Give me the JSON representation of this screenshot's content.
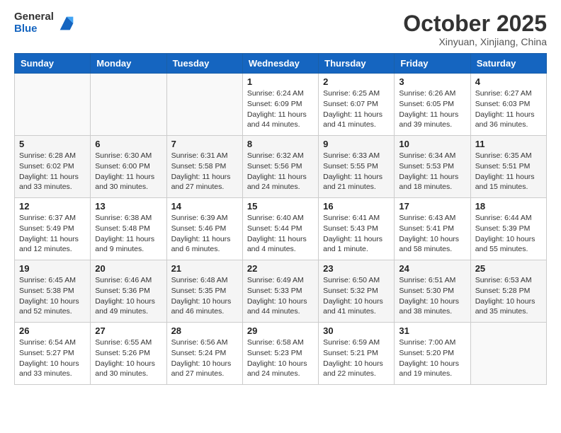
{
  "header": {
    "logo_general": "General",
    "logo_blue": "Blue",
    "month_title": "October 2025",
    "location": "Xinyuan, Xinjiang, China"
  },
  "days_of_week": [
    "Sunday",
    "Monday",
    "Tuesday",
    "Wednesday",
    "Thursday",
    "Friday",
    "Saturday"
  ],
  "weeks": [
    [
      {
        "day": "",
        "info": ""
      },
      {
        "day": "",
        "info": ""
      },
      {
        "day": "",
        "info": ""
      },
      {
        "day": "1",
        "info": "Sunrise: 6:24 AM\nSunset: 6:09 PM\nDaylight: 11 hours\nand 44 minutes."
      },
      {
        "day": "2",
        "info": "Sunrise: 6:25 AM\nSunset: 6:07 PM\nDaylight: 11 hours\nand 41 minutes."
      },
      {
        "day": "3",
        "info": "Sunrise: 6:26 AM\nSunset: 6:05 PM\nDaylight: 11 hours\nand 39 minutes."
      },
      {
        "day": "4",
        "info": "Sunrise: 6:27 AM\nSunset: 6:03 PM\nDaylight: 11 hours\nand 36 minutes."
      }
    ],
    [
      {
        "day": "5",
        "info": "Sunrise: 6:28 AM\nSunset: 6:02 PM\nDaylight: 11 hours\nand 33 minutes."
      },
      {
        "day": "6",
        "info": "Sunrise: 6:30 AM\nSunset: 6:00 PM\nDaylight: 11 hours\nand 30 minutes."
      },
      {
        "day": "7",
        "info": "Sunrise: 6:31 AM\nSunset: 5:58 PM\nDaylight: 11 hours\nand 27 minutes."
      },
      {
        "day": "8",
        "info": "Sunrise: 6:32 AM\nSunset: 5:56 PM\nDaylight: 11 hours\nand 24 minutes."
      },
      {
        "day": "9",
        "info": "Sunrise: 6:33 AM\nSunset: 5:55 PM\nDaylight: 11 hours\nand 21 minutes."
      },
      {
        "day": "10",
        "info": "Sunrise: 6:34 AM\nSunset: 5:53 PM\nDaylight: 11 hours\nand 18 minutes."
      },
      {
        "day": "11",
        "info": "Sunrise: 6:35 AM\nSunset: 5:51 PM\nDaylight: 11 hours\nand 15 minutes."
      }
    ],
    [
      {
        "day": "12",
        "info": "Sunrise: 6:37 AM\nSunset: 5:49 PM\nDaylight: 11 hours\nand 12 minutes."
      },
      {
        "day": "13",
        "info": "Sunrise: 6:38 AM\nSunset: 5:48 PM\nDaylight: 11 hours\nand 9 minutes."
      },
      {
        "day": "14",
        "info": "Sunrise: 6:39 AM\nSunset: 5:46 PM\nDaylight: 11 hours\nand 6 minutes."
      },
      {
        "day": "15",
        "info": "Sunrise: 6:40 AM\nSunset: 5:44 PM\nDaylight: 11 hours\nand 4 minutes."
      },
      {
        "day": "16",
        "info": "Sunrise: 6:41 AM\nSunset: 5:43 PM\nDaylight: 11 hours\nand 1 minute."
      },
      {
        "day": "17",
        "info": "Sunrise: 6:43 AM\nSunset: 5:41 PM\nDaylight: 10 hours\nand 58 minutes."
      },
      {
        "day": "18",
        "info": "Sunrise: 6:44 AM\nSunset: 5:39 PM\nDaylight: 10 hours\nand 55 minutes."
      }
    ],
    [
      {
        "day": "19",
        "info": "Sunrise: 6:45 AM\nSunset: 5:38 PM\nDaylight: 10 hours\nand 52 minutes."
      },
      {
        "day": "20",
        "info": "Sunrise: 6:46 AM\nSunset: 5:36 PM\nDaylight: 10 hours\nand 49 minutes."
      },
      {
        "day": "21",
        "info": "Sunrise: 6:48 AM\nSunset: 5:35 PM\nDaylight: 10 hours\nand 46 minutes."
      },
      {
        "day": "22",
        "info": "Sunrise: 6:49 AM\nSunset: 5:33 PM\nDaylight: 10 hours\nand 44 minutes."
      },
      {
        "day": "23",
        "info": "Sunrise: 6:50 AM\nSunset: 5:32 PM\nDaylight: 10 hours\nand 41 minutes."
      },
      {
        "day": "24",
        "info": "Sunrise: 6:51 AM\nSunset: 5:30 PM\nDaylight: 10 hours\nand 38 minutes."
      },
      {
        "day": "25",
        "info": "Sunrise: 6:53 AM\nSunset: 5:28 PM\nDaylight: 10 hours\nand 35 minutes."
      }
    ],
    [
      {
        "day": "26",
        "info": "Sunrise: 6:54 AM\nSunset: 5:27 PM\nDaylight: 10 hours\nand 33 minutes."
      },
      {
        "day": "27",
        "info": "Sunrise: 6:55 AM\nSunset: 5:26 PM\nDaylight: 10 hours\nand 30 minutes."
      },
      {
        "day": "28",
        "info": "Sunrise: 6:56 AM\nSunset: 5:24 PM\nDaylight: 10 hours\nand 27 minutes."
      },
      {
        "day": "29",
        "info": "Sunrise: 6:58 AM\nSunset: 5:23 PM\nDaylight: 10 hours\nand 24 minutes."
      },
      {
        "day": "30",
        "info": "Sunrise: 6:59 AM\nSunset: 5:21 PM\nDaylight: 10 hours\nand 22 minutes."
      },
      {
        "day": "31",
        "info": "Sunrise: 7:00 AM\nSunset: 5:20 PM\nDaylight: 10 hours\nand 19 minutes."
      },
      {
        "day": "",
        "info": ""
      }
    ]
  ]
}
